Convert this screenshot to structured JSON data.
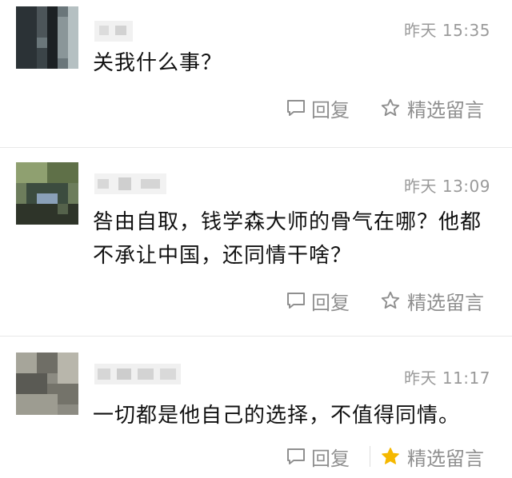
{
  "comments": [
    {
      "time": "昨天 15:35",
      "text": "关我什么事？",
      "reply_label": "回复",
      "feature_label": "精选留言",
      "featured": false
    },
    {
      "time": "昨天 13:09",
      "text": "咎由自取，钱学森大师的骨气在哪？他都不承让中国，还同情干啥？",
      "reply_label": "回复",
      "feature_label": "精选留言",
      "featured": false
    },
    {
      "time": "昨天 11:17",
      "text": "一切都是他自己的选择，不值得同情。",
      "reply_label": "回复",
      "feature_label": "精选留言",
      "featured": true
    }
  ],
  "colors": {
    "star_active": "#f5b800",
    "muted_text": "#9a9a9a"
  },
  "icons": {
    "reply": "comment-bubble-icon",
    "feature": "star-icon"
  }
}
